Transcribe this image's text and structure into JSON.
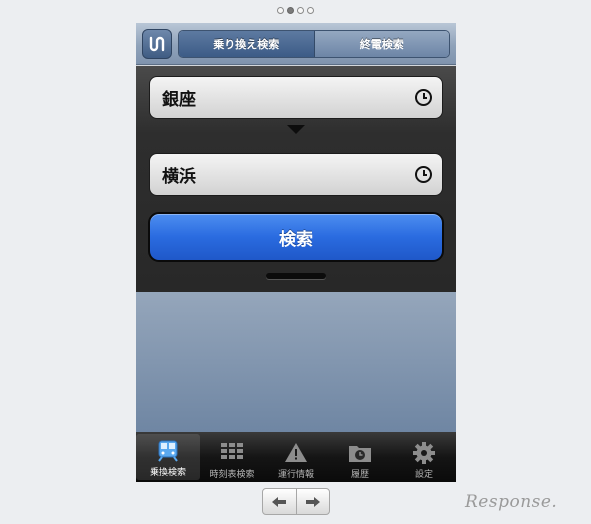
{
  "pagination": {
    "total": 4,
    "current_index": 1
  },
  "topbar": {
    "segments": [
      {
        "label": "乗り換え検索",
        "selected": true
      },
      {
        "label": "終電検索",
        "selected": false
      }
    ]
  },
  "search": {
    "from_station": "銀座",
    "to_station": "横浜",
    "search_button_label": "検索"
  },
  "tabbar": {
    "items": [
      {
        "label": "乗換検索",
        "icon": "train-icon",
        "selected": true
      },
      {
        "label": "時刻表検索",
        "icon": "timetable-grid-icon",
        "selected": false
      },
      {
        "label": "運行情報",
        "icon": "warning-icon",
        "selected": false
      },
      {
        "label": "履歴",
        "icon": "history-folder-icon",
        "selected": false
      },
      {
        "label": "設定",
        "icon": "gear-icon",
        "selected": false
      }
    ]
  },
  "brand": {
    "text": "Response."
  },
  "colors": {
    "search_button": "#2a6be0",
    "navbar": "#8fa2ba",
    "panel": "#2e2e2e"
  }
}
